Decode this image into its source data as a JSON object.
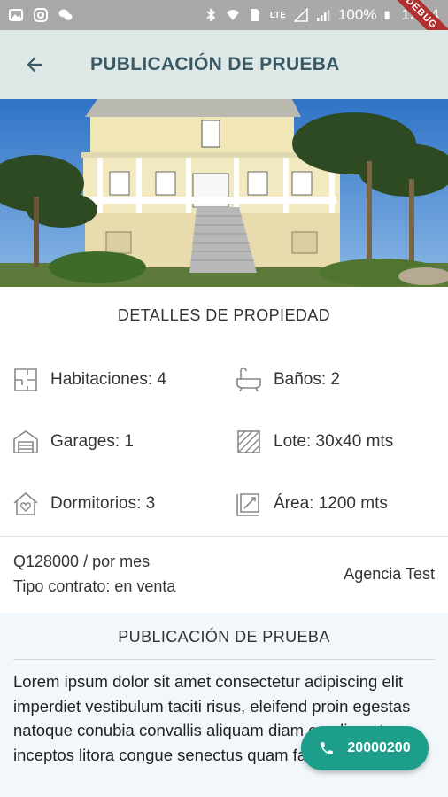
{
  "status_bar": {
    "battery": "100%",
    "time": "12:04",
    "network": "LTE",
    "debug_label": "DEBUG"
  },
  "app_bar": {
    "title": "PUBLICACIÓN DE PRUEBA",
    "back_icon": "arrow-back-icon"
  },
  "hero": {
    "description_icon": "house-photo"
  },
  "details": {
    "title": "DETALLES DE PROPIEDAD",
    "features": [
      {
        "icon": "floorplan-icon",
        "label": "Habitaciones: 4"
      },
      {
        "icon": "bathtub-icon",
        "label": "Baños: 2"
      },
      {
        "icon": "garage-icon",
        "label": "Garages: 1"
      },
      {
        "icon": "lot-icon",
        "label": "Lote: 30x40 mts"
      },
      {
        "icon": "home-heart-icon",
        "label": "Dormitorios: 3"
      },
      {
        "icon": "area-icon",
        "label": "Área: 1200 mts"
      }
    ]
  },
  "listing": {
    "price": "Q128000 / por mes",
    "contract": "Tipo contrato: en venta",
    "agency": "Agencia Test"
  },
  "description": {
    "title": "PUBLICACIÓN DE PRUEBA",
    "body": "Lorem ipsum dolor sit amet consectetur adipiscing elit imperdiet vestibulum taciti risus, eleifend proin egestas natoque conubia convallis aliquam diam condimentum inceptos litora congue senectus quam facilisi mauris"
  },
  "call_button": {
    "label": "20000200",
    "icon": "phone-icon"
  },
  "colors": {
    "app_bar_bg": "#dde8e7",
    "title_color": "#3b5964",
    "fab_bg": "#1d9e8a",
    "desc_bg": "#f1f7fa"
  }
}
